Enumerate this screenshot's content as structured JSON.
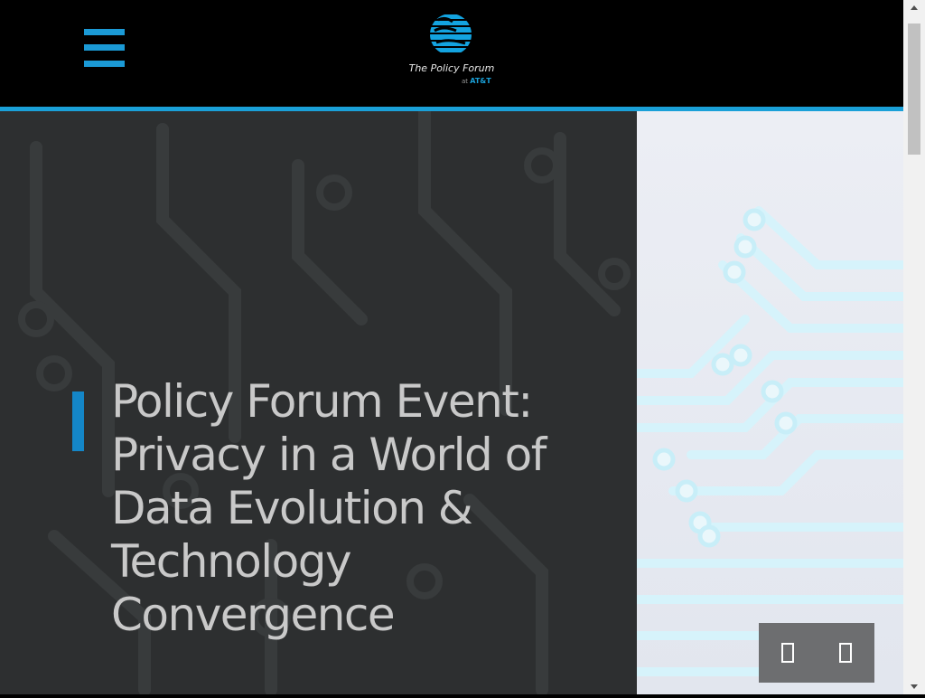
{
  "header": {
    "menu_icon": "hamburger-menu-icon",
    "logo": {
      "icon": "att-globe-icon",
      "name": "The Policy Forum",
      "sub_prefix": "at",
      "sub_brand": "AT&T"
    },
    "accent_color": "#1aa0d8"
  },
  "hero": {
    "title": "Policy Forum Event: Privacy in a World of Data Evolution & Technology Convergence",
    "accent_color": "#1486c7",
    "left_bg": "#2d2f30",
    "right_bg": "#e6e9f1",
    "slider": {
      "prev_icon": "chevron-left-icon",
      "next_icon": "chevron-right-icon",
      "bg": "#6d6e70"
    }
  },
  "scrollbar": {
    "up_icon": "scroll-up-arrow-icon",
    "down_icon": "scroll-down-arrow-icon"
  }
}
